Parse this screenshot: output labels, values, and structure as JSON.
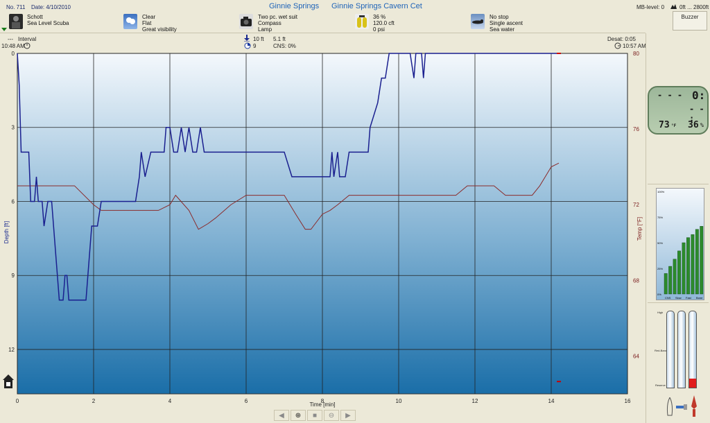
{
  "header": {
    "dive_no": "No. 711",
    "date": "Date: 4/10/2010",
    "site": "Ginnie Springs",
    "location": "Ginnie Springs Cavern Cet",
    "mb_level": "MB-level: 0",
    "altitude": "0ft ... 2800ft",
    "buzzer": "Buzzer",
    "diver": [
      "Schott",
      "Sea Level Scuba"
    ],
    "weather": [
      "Clear",
      "Flat",
      "Great visibility"
    ],
    "equipment": [
      "Two pc. wet suit",
      "Compass",
      "Lamp"
    ],
    "gas": [
      "36 %",
      "120.0 cft",
      "0 psi"
    ],
    "deco": [
      "No stop",
      "Single ascent",
      "Sea water"
    ]
  },
  "stats": {
    "interval_label": "Interval",
    "interval_value": "---",
    "start_time": "10:48 AM",
    "max_depth": "10 ft",
    "avg_depth": "5.1 ft",
    "cns_num": "9",
    "cns": "CNS:  0%",
    "desat": "Desat:  0:05",
    "end_time": "10:57 AM"
  },
  "axes": {
    "depth_label": "Depth [ft]",
    "temp_label": "Temp [°F]",
    "time_label": "Time [min]",
    "x_ticks": [
      "0",
      "2",
      "4",
      "6",
      "8",
      "10",
      "12",
      "14",
      "16"
    ],
    "depth_ticks": [
      "0",
      "3",
      "6",
      "9",
      "12"
    ],
    "temp_ticks": [
      "80",
      "76",
      "72",
      "68",
      "64"
    ]
  },
  "chart_data": {
    "type": "line",
    "xlabel": "Time [min]",
    "ylabel": "Depth [ft]",
    "y2label": "Temp [°F]",
    "xlim": [
      0,
      16
    ],
    "ylim": [
      0,
      13.8
    ],
    "y2lim": [
      62,
      80
    ],
    "series": [
      {
        "name": "Depth",
        "color": "#1a1f8f",
        "x": [
          0,
          0.05,
          0.1,
          0.3,
          0.35,
          0.45,
          0.5,
          0.55,
          0.65,
          0.7,
          0.8,
          0.9,
          1.0,
          1.05,
          1.1,
          1.2,
          1.25,
          1.3,
          1.35,
          1.45,
          1.55,
          1.7,
          1.8,
          1.85,
          1.95,
          2.1,
          2.2,
          2.3,
          2.5,
          2.7,
          2.9,
          3.1,
          3.2,
          3.25,
          3.35,
          3.5,
          3.55,
          3.6,
          3.75,
          3.85,
          3.9,
          4.0,
          4.1,
          4.2,
          4.3,
          4.4,
          4.5,
          4.6,
          4.7,
          4.8,
          4.9,
          5.0,
          5.2,
          5.5,
          6.0,
          6.5,
          7.0,
          7.1,
          7.2,
          7.5,
          8.0,
          8.2,
          8.25,
          8.3,
          8.4,
          8.45,
          8.6,
          8.7,
          8.75,
          9.0,
          9.2,
          9.25,
          9.45,
          9.55,
          9.65,
          9.75,
          9.85,
          10.0,
          10.3,
          10.4,
          10.45,
          10.5,
          10.6,
          10.65,
          10.7,
          10.75,
          10.8,
          11.0,
          11.5,
          12.0,
          12.5,
          13.0,
          13.5,
          14.0,
          14.2
        ],
        "values": [
          0,
          1.3,
          4,
          4,
          6,
          6,
          5,
          6,
          6,
          7,
          6,
          6,
          8,
          9,
          10,
          10,
          9,
          9,
          10,
          10,
          10,
          10,
          10,
          9,
          7,
          7,
          6,
          6,
          6,
          6,
          6,
          6,
          5,
          4,
          5,
          4,
          4,
          4,
          4,
          4,
          3,
          3,
          4,
          4,
          3,
          4,
          3,
          4,
          4,
          3,
          4,
          4,
          4,
          4,
          4,
          4,
          4,
          4.5,
          5,
          5,
          5,
          5,
          4,
          5,
          4,
          5,
          5,
          4,
          4,
          4,
          4,
          3,
          2,
          1,
          1,
          0,
          0,
          0,
          0,
          1,
          0,
          0,
          0,
          1,
          0,
          0,
          0,
          0,
          0,
          0,
          0,
          0,
          0,
          0,
          0
        ]
      },
      {
        "name": "Temperature",
        "color": "#8b2a2a",
        "x": [
          0,
          1.5,
          2.0,
          2.2,
          3.7,
          4.0,
          4.15,
          4.5,
          4.75,
          5.0,
          5.2,
          5.6,
          6.0,
          6.5,
          7.0,
          7.3,
          7.55,
          7.7,
          8.0,
          8.2,
          8.4,
          8.7,
          9.0,
          10.0,
          11.5,
          11.8,
          12.2,
          12.5,
          12.8,
          13.2,
          13.5,
          13.7,
          14.0,
          14.2
        ],
        "values": [
          73,
          73,
          72,
          71.7,
          71.7,
          72,
          72.5,
          71.7,
          70.7,
          71,
          71.3,
          72,
          72.5,
          72.5,
          72.5,
          71.5,
          70.7,
          70.7,
          71.5,
          71.7,
          72,
          72.5,
          72.5,
          72.5,
          72.5,
          73,
          73,
          73,
          72.5,
          72.5,
          72.5,
          73,
          74,
          74.2
        ]
      }
    ]
  },
  "lcd": {
    "top_left": "- - -",
    "top_right": "0:",
    "mid_right": "- - :",
    "bottom_left": "73",
    "bottom_left_unit": "°F",
    "bottom_right": "36",
    "bottom_right_unit": "%"
  },
  "tissue_chart": {
    "y_labels": [
      "100%",
      "75%",
      "50%",
      "25%",
      "0%"
    ],
    "x_labels": [
      "CNS",
      "Slow",
      "Fast",
      "Bone"
    ],
    "bar_values": [
      0.2,
      0.27,
      0.34,
      0.42,
      0.5,
      0.55,
      0.58,
      0.63,
      0.66
    ],
    "color": "#2c8b2c"
  },
  "gauges": {
    "labels": [
      "High",
      "Red-Band",
      "Reserve"
    ],
    "values": [
      0,
      0,
      0.12
    ],
    "fill_color": "#e11d1d"
  },
  "toolbar": {
    "prev": "◀",
    "zoom_in": "⊕",
    "stop": "■",
    "zoom_out": "⊖",
    "next": "▶"
  }
}
